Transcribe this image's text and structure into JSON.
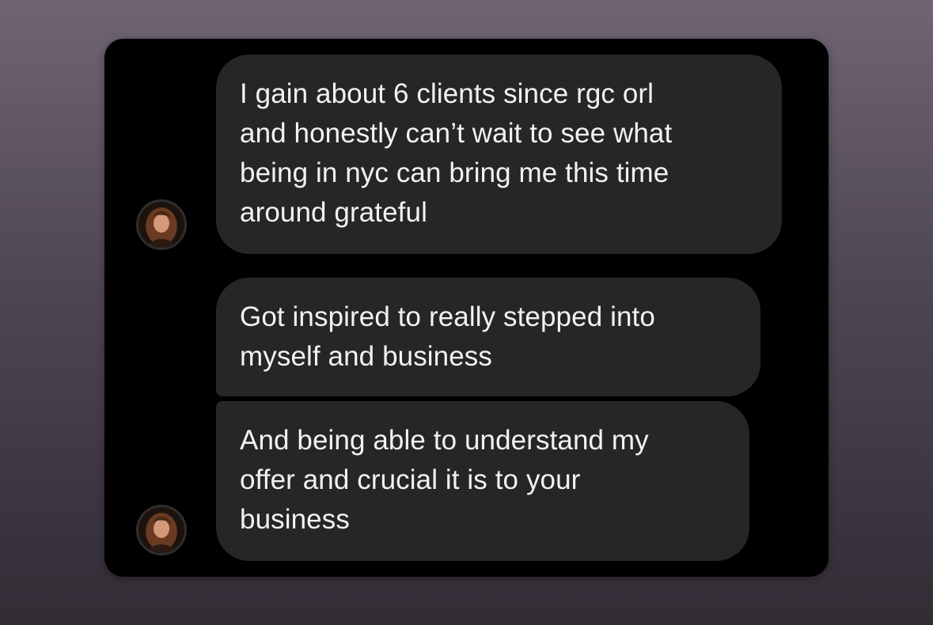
{
  "conversation": {
    "messages": [
      {
        "text": "I gain about 6 clients since rgc orl\nand honestly can’t wait to see what\nbeing in nyc can bring me this time\naround grateful"
      },
      {
        "text": "Got inspired to really stepped into\nmyself and business"
      },
      {
        "text": "And being able to understand my\noffer and crucial it is to your\nbusiness"
      }
    ],
    "avatar_icon": "profile-photo",
    "colors": {
      "panel_background": "#000000",
      "bubble_background": "#262626",
      "text": "#f2f2f2"
    }
  }
}
